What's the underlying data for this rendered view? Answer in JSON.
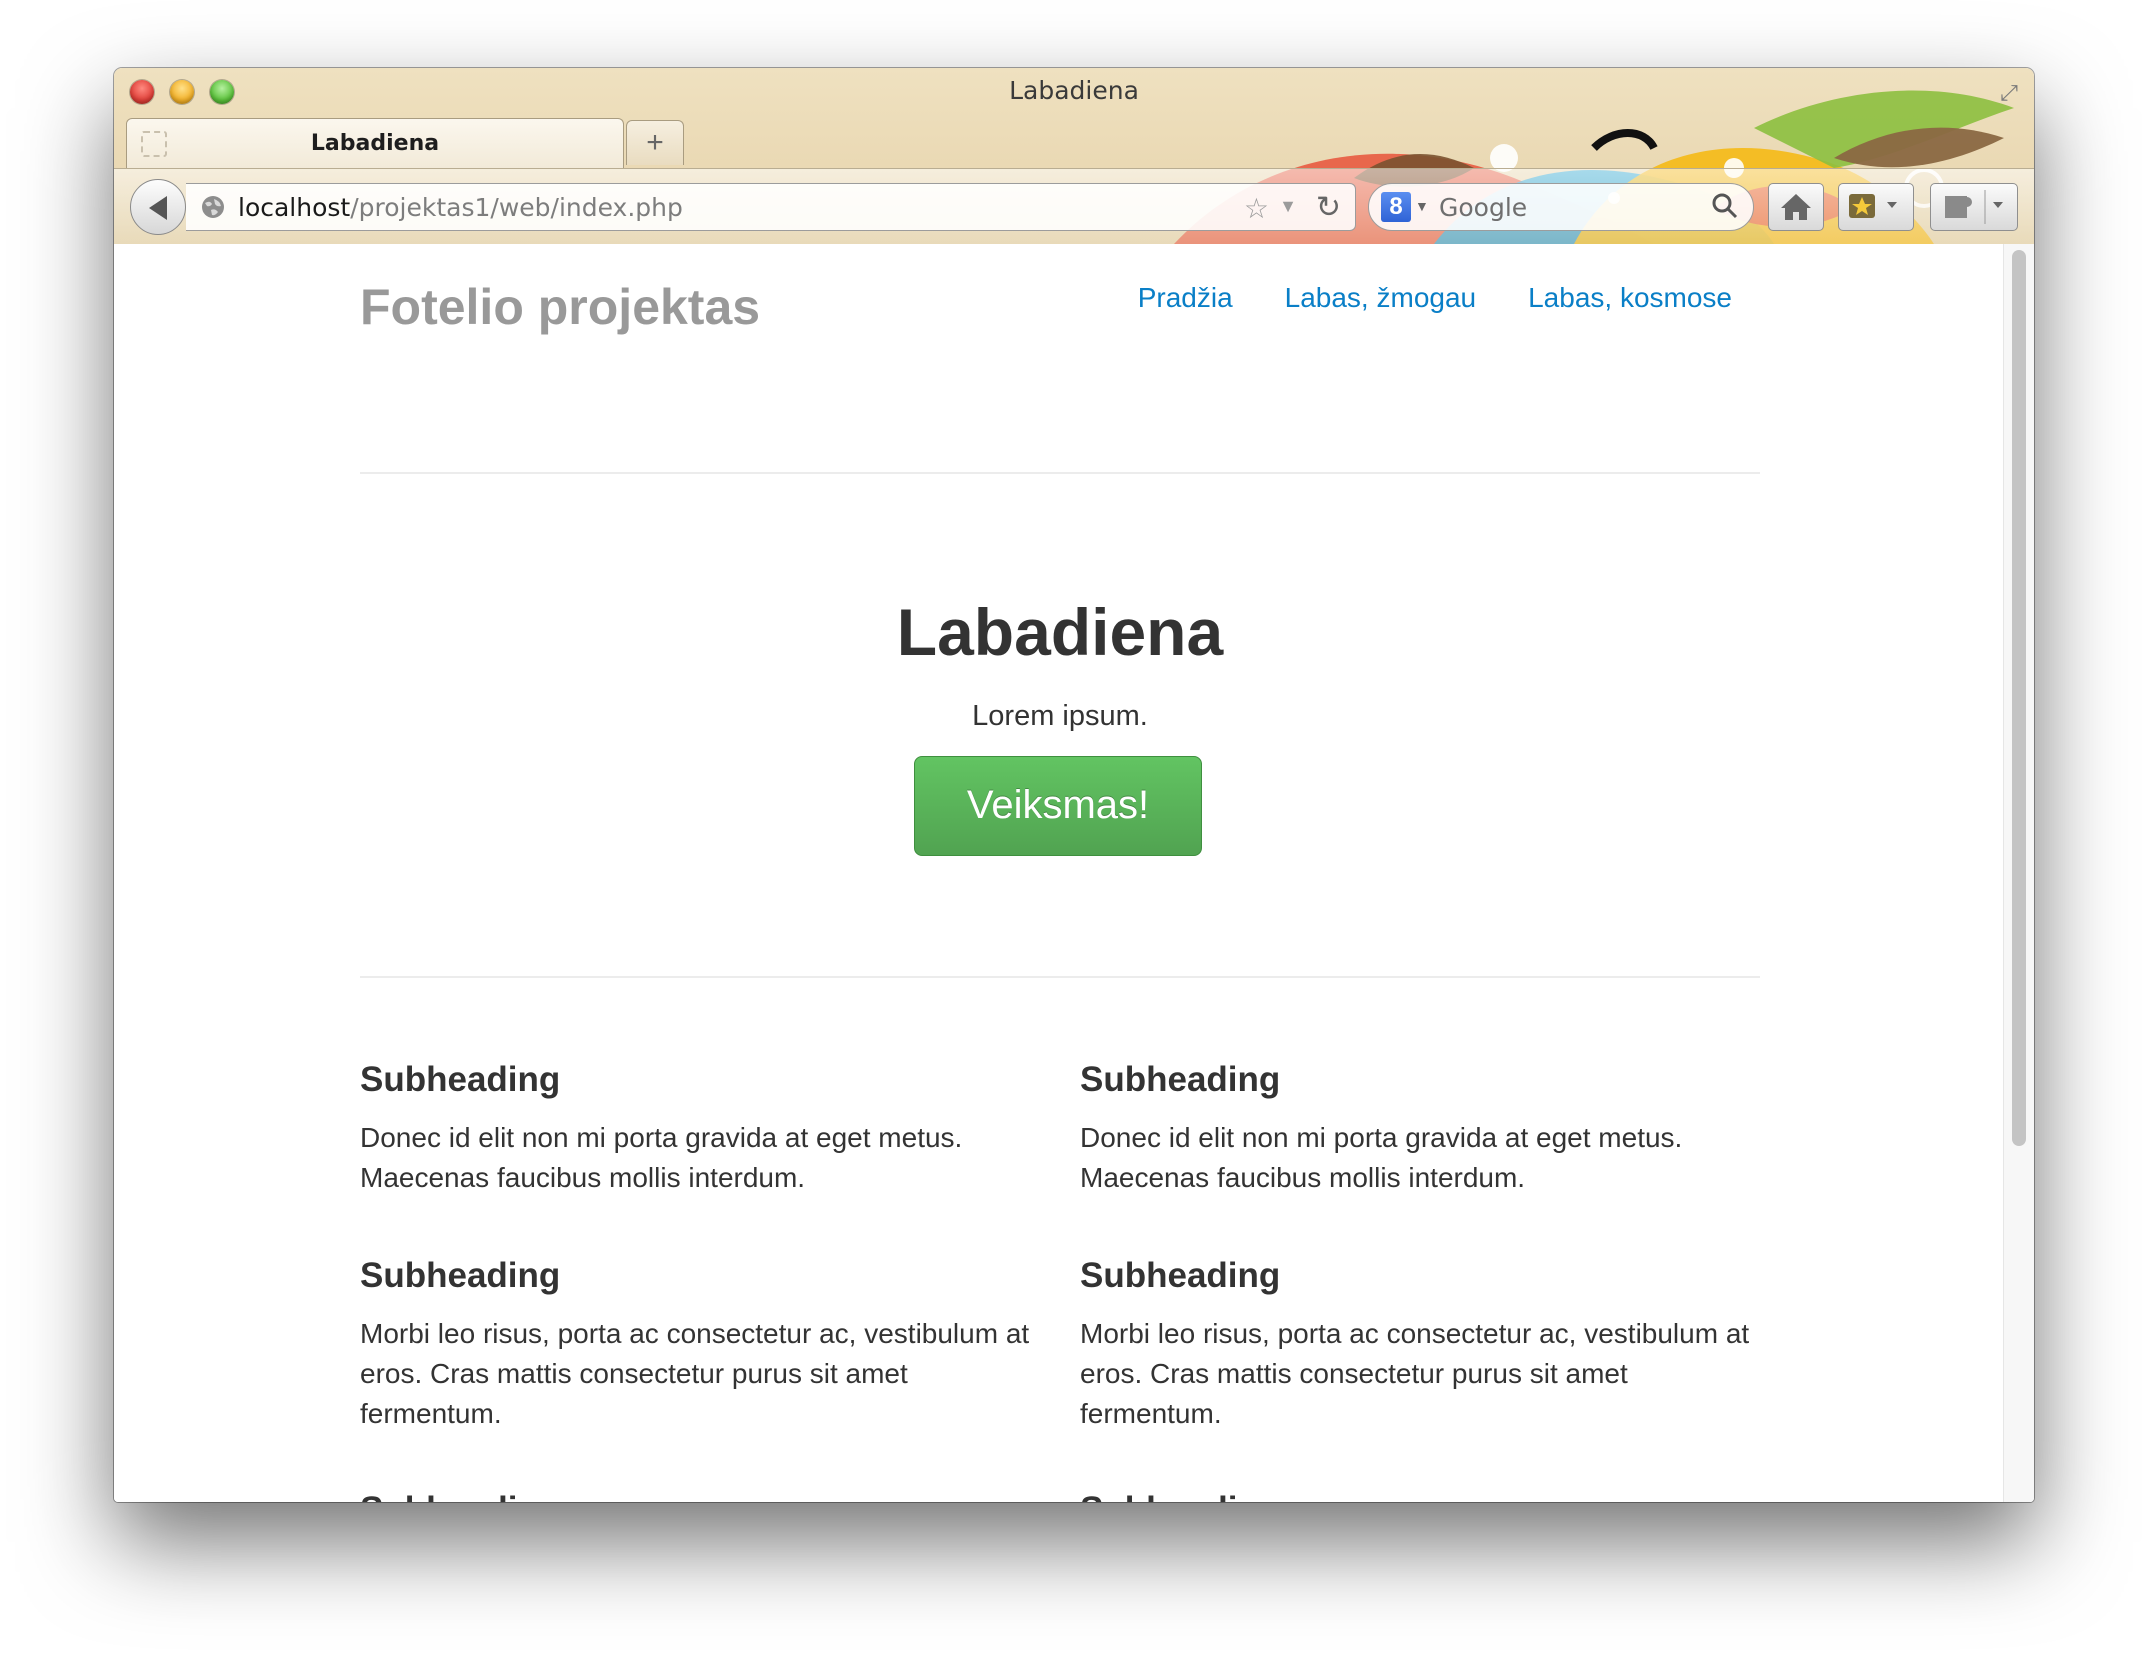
{
  "window": {
    "title": "Labadiena",
    "tab_label": "Labadiena",
    "new_tab": "+"
  },
  "toolbar": {
    "url_host": "localhost",
    "url_path": "/projektas1/web/index.php",
    "search_placeholder": "Google",
    "search_engine_icon": "8"
  },
  "page": {
    "brand": "Fotelio projektas",
    "nav": [
      "Pradžia",
      "Labas, žmogau",
      "Labas, kosmose"
    ],
    "hero_title": "Labadiena",
    "hero_lead": "Lorem ipsum.",
    "cta_label": "Veiksmas!",
    "features": [
      {
        "heading": "Subheading",
        "text": "Donec id elit non mi porta gravida at eget metus. Maecenas faucibus mollis interdum."
      },
      {
        "heading": "Subheading",
        "text": "Donec id elit non mi porta gravida at eget metus. Maecenas faucibus mollis interdum."
      },
      {
        "heading": "Subheading",
        "text": "Morbi leo risus, porta ac consectetur ac, vestibulum at eros. Cras mattis consectetur purus sit amet fermentum."
      },
      {
        "heading": "Subheading",
        "text": "Morbi leo risus, porta ac consectetur ac, vestibulum at eros. Cras mattis consectetur purus sit amet fermentum."
      },
      {
        "heading": "Subheading",
        "text": ""
      },
      {
        "heading": "Subheading",
        "text": ""
      }
    ]
  },
  "colors": {
    "link": "#0a7fc7",
    "button_green": "#5bb75b",
    "brand_gray": "#999999"
  }
}
